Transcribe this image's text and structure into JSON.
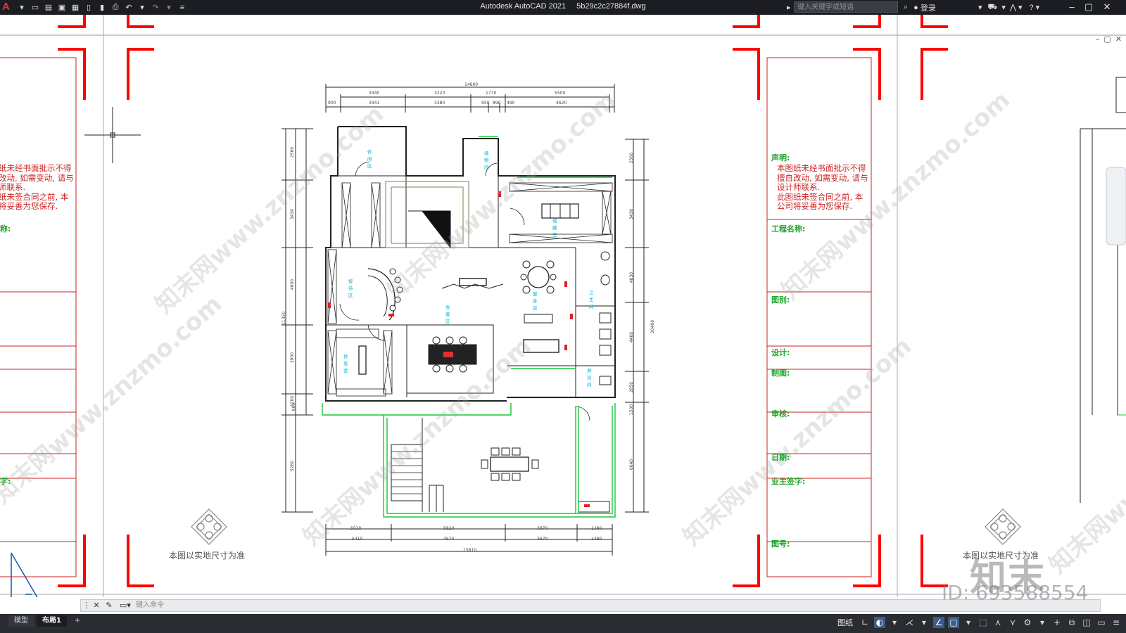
{
  "titlebar": {
    "app_name": "Autodesk AutoCAD 2021",
    "file_name": "5b29c2c27884f.dwg",
    "search_placeholder": "键入关键字或短语",
    "login_label": "登录"
  },
  "layout_tabs": [
    {
      "label": "模型",
      "active": false
    },
    {
      "label": "布局1",
      "active": true
    }
  ],
  "add_tab_label": "+",
  "command_line": {
    "placeholder": "键入命令"
  },
  "statusbar": {
    "paper_label": "图纸"
  },
  "title_block": {
    "declaration_title": "声明:",
    "declaration_lines": [
      "本图纸未经书面批示不得",
      "擅自改动, 如需变动, 请与",
      "设计师联系.",
      "此图纸未签合同之前, 本",
      "公司将妥善为您保存."
    ],
    "fields": [
      "工程名称:",
      "图别:",
      "设计:",
      "制图:",
      "审核:",
      "日期:",
      "业主签字:",
      "图号:"
    ],
    "left_partial_lines": [
      "纸未经书面批示不得",
      "改动, 如需变动, 请与",
      "师联系.",
      "纸未签合同之前, 本",
      "将妥善为您保存."
    ],
    "left_partial_fields": [
      "称:",
      "字:"
    ]
  },
  "plan": {
    "dimensions_top_outer": "14600",
    "dimensions_top_row1": [
      "3340",
      "3220",
      "1770",
      "5500"
    ],
    "dimensions_top_row2": [
      "900",
      "3341",
      "3380",
      "950",
      "890",
      "490",
      "4620"
    ],
    "dimensions_bottom_row1": [
      "5010",
      "5820",
      "3670",
      "1480"
    ],
    "dimensions_bottom_row2": [
      "5410",
      "4570",
      "3670",
      "1480"
    ],
    "dimensions_bottom_outer": "15810",
    "dimensions_left": [
      "2560",
      "3430",
      "4900",
      "3900",
      "1200",
      "880",
      "5280"
    ],
    "dimensions_left_outer": "11350",
    "dimensions_right": [
      "2560",
      "3430",
      "4830",
      "4460",
      "2850",
      "1500",
      "6640"
    ],
    "dimensions_right_outer": "20400",
    "room_labels": [
      "休闲区",
      "储物间",
      "储藏室",
      "接待区",
      "会客区",
      "休息室",
      "健身房",
      "卫生间",
      "淋浴间",
      "茶室"
    ]
  },
  "scale_note": "本图以实地尺寸为准",
  "compass_letters": [
    "A",
    "B",
    "C",
    "D"
  ],
  "watermark": {
    "logo_text": "知末",
    "id_text": "ID: 693588554",
    "diagonal_text": "知末网www.znzmo.com"
  },
  "colors": {
    "titlebar_bg": "#1b1d22",
    "frame_red": "#ff0000",
    "field_green": "#1fa52b",
    "declaration_red": "#cc2222",
    "cyan": "#00b7d4",
    "statusbar_bg": "#2a2c31"
  }
}
